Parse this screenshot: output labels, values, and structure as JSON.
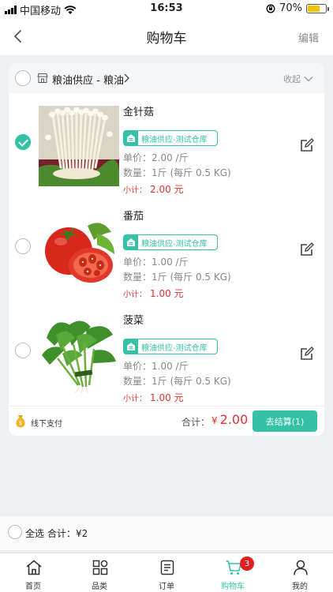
{
  "status_bar": {
    "carrier": "中国移动",
    "time": "16:53",
    "battery": "70%",
    "battery_level": 0.7
  },
  "navbar": {
    "title": "购物车",
    "edit_label": "编辑"
  },
  "shop": {
    "name": "粮油供应 - 粮油",
    "collapse_label": "收起",
    "items": [
      {
        "name": "金针菇",
        "warehouse": "粮油供应-测试仓库",
        "price": "单价：2.00 /斤",
        "quantity": "数量：1斤 (每斤 0.5 KG)",
        "subtotal_label": "小计：",
        "subtotal_value": "2.00 元",
        "checked": true,
        "image": "enoki-mushroom"
      },
      {
        "name": "番茄",
        "warehouse": "粮油供应-测试仓库",
        "price": "单价：1.00 /斤",
        "quantity": "数量：1斤 (每斤 0.5 KG)",
        "subtotal_label": "小计：",
        "subtotal_value": "1.00 元",
        "checked": false,
        "image": "tomato"
      },
      {
        "name": "菠菜",
        "warehouse": "粮油供应-测试仓库",
        "price": "单价：1.00 /斤",
        "quantity": "数量：1斤 (每斤 0.5 KG)",
        "subtotal_label": "小计：",
        "subtotal_value": "1.00 元",
        "checked": false,
        "image": "spinach"
      }
    ],
    "footer": {
      "payment_label": "线下支付",
      "total_label": "合计：",
      "currency": "¥",
      "total_value": "2.00",
      "checkout_label": "去结算(1)"
    }
  },
  "select_bar": {
    "select_all_label": "全选",
    "total_text": "合计：¥2"
  },
  "tabs": [
    {
      "label": "首页",
      "icon": "home-icon"
    },
    {
      "label": "品类",
      "icon": "category-icon"
    },
    {
      "label": "订单",
      "icon": "order-icon"
    },
    {
      "label": "购物车",
      "icon": "cart-icon",
      "badge": "3",
      "active": true
    },
    {
      "label": "我的",
      "icon": "user-icon"
    }
  ],
  "colors": {
    "accent": "#33c2a5",
    "price_red": "#e03232",
    "badge_red": "#e02020"
  }
}
